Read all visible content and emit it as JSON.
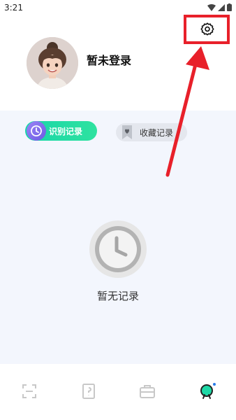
{
  "status_bar": {
    "time": "3:21"
  },
  "profile": {
    "name": "暂未登录"
  },
  "tabs": [
    {
      "label": "识别记录",
      "active": true
    },
    {
      "label": "收藏记录",
      "active": false
    }
  ],
  "empty_state": {
    "text": "暂无记录"
  },
  "icons": {
    "settings": "gear-icon",
    "nav": [
      "scan-icon",
      "book-icon",
      "briefcase-icon",
      "profile-icon"
    ]
  },
  "colors": {
    "annotation": "#e8202a",
    "accent_green": "#1ed8a6",
    "content_bg": "#f3f6fd",
    "nav_active": "#1ed8a6",
    "nav_inactive": "#c8c8c8"
  }
}
